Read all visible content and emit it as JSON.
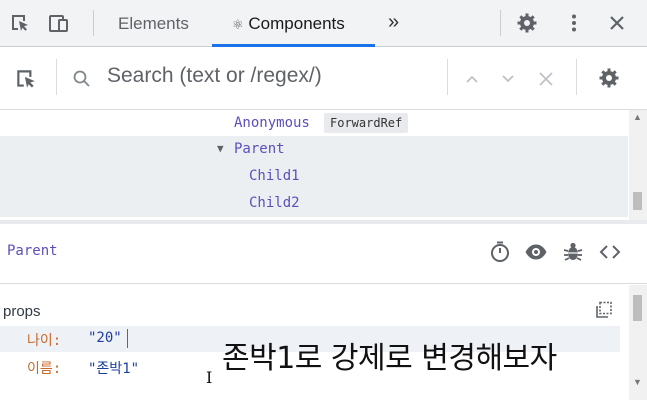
{
  "tabs": {
    "elements_label": "Elements",
    "components_label": "Components",
    "components_glyph": "⚛",
    "more_label": "»"
  },
  "search": {
    "placeholder": "Search (text or /regex/)"
  },
  "tree": {
    "rows": [
      {
        "name": "Anonymous",
        "badge": "ForwardRef"
      },
      {
        "name": "Parent",
        "expanded": true,
        "selected": true
      },
      {
        "name": "Child1"
      },
      {
        "name": "Child2"
      }
    ]
  },
  "inspector": {
    "component_name": "Parent",
    "props_title": "props",
    "props": [
      {
        "key": "나이:",
        "value": "\"20\""
      },
      {
        "key": "이름:",
        "value": "\"존박1\""
      }
    ]
  },
  "overlay_caption": "존박1로 강제로 변경해보자",
  "colors": {
    "accent": "#1a73e8",
    "component_name": "#5b4fbe",
    "prop_key": "#c76a2a",
    "prop_value": "#1f3f9e"
  }
}
